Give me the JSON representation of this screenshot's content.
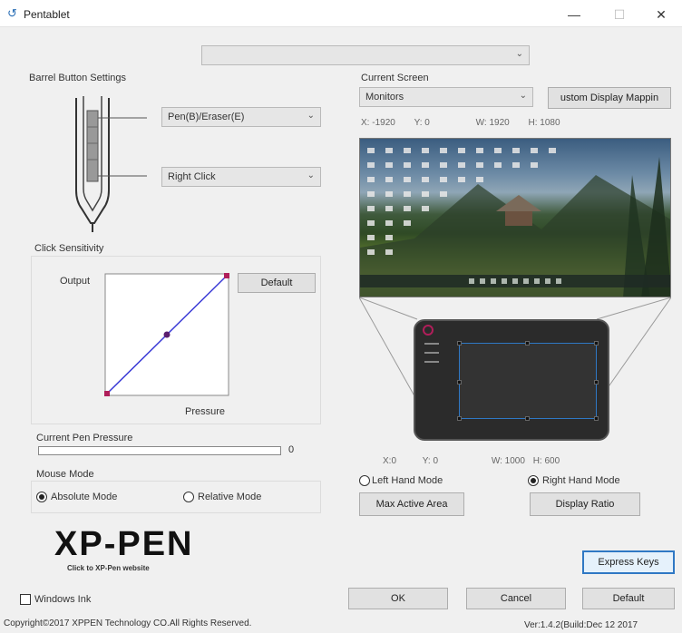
{
  "window": {
    "title": "Pentablet",
    "minimize": "—",
    "maximize": "☐",
    "close": "✕"
  },
  "device_select": {
    "value": ""
  },
  "barrel": {
    "title": "Barrel Button Settings",
    "upper_value": "Pen(B)/Eraser(E)",
    "lower_value": "Right Click"
  },
  "click_sensitivity": {
    "title": "Click Sensitivity",
    "output_label": "Output",
    "pressure_label": "Pressure",
    "default_button": "Default"
  },
  "pen_pressure": {
    "label": "Current Pen Pressure",
    "value": "0",
    "level": 0
  },
  "mouse_mode": {
    "title": "Mouse Mode",
    "absolute": "Absolute Mode",
    "relative": "Relative Mode",
    "selected": "absolute"
  },
  "current_screen": {
    "title": "Current Screen",
    "monitor_value": "Monitors",
    "mapping_button": "ustom Display Mappin",
    "x_label": "X:",
    "x_value": "-1920",
    "y_label": "Y:",
    "y_value": "0",
    "w_label": "W:",
    "w_value": "1920",
    "h_label": "H:",
    "h_value": "1080"
  },
  "tablet_area": {
    "x_label": "X:",
    "x_value": "0",
    "y_label": "Y:",
    "y_value": "0",
    "w_label": "W:",
    "w_value": "1000",
    "h_label": "H:",
    "h_value": "600"
  },
  "hand_mode": {
    "left": "Left Hand Mode",
    "right": "Right Hand Mode",
    "selected": "right"
  },
  "buttons": {
    "max_active_area": "Max Active Area",
    "display_ratio": "Display Ratio",
    "express_keys": "Express Keys",
    "ok": "OK",
    "cancel": "Cancel",
    "default": "Default"
  },
  "brand": {
    "logo": "XP-PEN",
    "link": "Click to XP-Pen website"
  },
  "windows_ink": {
    "label": "Windows Ink",
    "checked": false
  },
  "footer": {
    "copyright": "Copyright©2017 XPPEN Technology CO.All Rights Reserved.",
    "version": "Ver:1.4.2(Build:Dec 12 2017"
  },
  "colors": {
    "curve": "#3b3bd6",
    "curve_point": "#b01e5a",
    "tablet_bg": "#2b2b2b",
    "accent_border": "#2f78c4"
  }
}
